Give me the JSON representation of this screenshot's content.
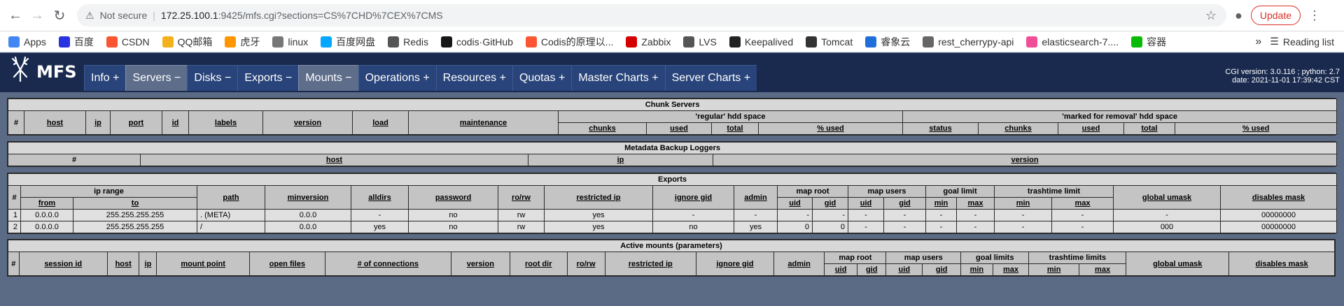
{
  "browser": {
    "not_secure": "Not secure",
    "url_host": "172.25.100.1",
    "url_rest": ":9425/mfs.cgi?sections=CS%7CHD%7CEX%7CMS",
    "update_label": "Update",
    "bookmarks": [
      {
        "label": "Apps",
        "icon": "apps-grid-icon",
        "color": "#4285f4"
      },
      {
        "label": "百度",
        "icon": "baidu-paw-icon",
        "color": "#2932e1"
      },
      {
        "label": "CSDN",
        "icon": "csdn-icon",
        "color": "#fc5531"
      },
      {
        "label": "QQ邮箱",
        "icon": "qqmail-icon",
        "color": "#f3b21b"
      },
      {
        "label": "虎牙",
        "icon": "huya-icon",
        "color": "#ff9600"
      },
      {
        "label": "linux",
        "icon": "linux-icon",
        "color": "#777777"
      },
      {
        "label": "百度网盘",
        "icon": "baidu-pan-icon",
        "color": "#06a7ff"
      },
      {
        "label": "Redis",
        "icon": "redis-icon",
        "color": "#555555"
      },
      {
        "label": "codis·GitHub",
        "icon": "github-icon",
        "color": "#181717"
      },
      {
        "label": "Codis的原理以...",
        "icon": "csdn-icon",
        "color": "#fc5531"
      },
      {
        "label": "Zabbix",
        "icon": "zabbix-icon",
        "color": "#d40000"
      },
      {
        "label": "LVS",
        "icon": "lvs-icon",
        "color": "#555555"
      },
      {
        "label": "Keepalived",
        "icon": "keepalived-icon",
        "color": "#222222"
      },
      {
        "label": "Tomcat",
        "icon": "tomcat-icon",
        "color": "#333333"
      },
      {
        "label": "睿象云",
        "icon": "ruixiang-icon",
        "color": "#1e6fd9"
      },
      {
        "label": "rest_cherrypy-api",
        "icon": "cherrypy-icon",
        "color": "#666666"
      },
      {
        "label": "elasticsearch-7....",
        "icon": "elastic-icon",
        "color": "#f04e98"
      },
      {
        "label": "容器",
        "icon": "wechat-icon",
        "color": "#09bb07"
      }
    ],
    "reading_list": "Reading list"
  },
  "mfs": {
    "logo_text": "MFS",
    "tabs": [
      {
        "label": "Info +",
        "active": false
      },
      {
        "label": "Servers −",
        "active": true
      },
      {
        "label": "Disks −",
        "active": false
      },
      {
        "label": "Exports −",
        "active": false
      },
      {
        "label": "Mounts −",
        "active": true
      },
      {
        "label": "Operations +",
        "active": false
      },
      {
        "label": "Resources +",
        "active": false
      },
      {
        "label": "Quotas +",
        "active": false
      },
      {
        "label": "Master Charts +",
        "active": false
      },
      {
        "label": "Server Charts +",
        "active": false
      }
    ],
    "version_line1": "CGI version: 3.0.116 ; python: 2.7",
    "version_line2": "date: 2021-11-01 17:39:42 CST"
  },
  "chunk_servers": {
    "title": "Chunk Servers",
    "cols": [
      "#",
      "host",
      "ip",
      "port",
      "id",
      "labels",
      "version",
      "load",
      "maintenance"
    ],
    "regular_title": "'regular' hdd space",
    "regular_cols": [
      "chunks",
      "used",
      "total",
      "% used"
    ],
    "removal_title": "'marked for removal' hdd space",
    "removal_cols": [
      "status",
      "chunks",
      "used",
      "total",
      "% used"
    ]
  },
  "backup_loggers": {
    "title": "Metadata Backup Loggers",
    "cols": [
      "#",
      "host",
      "ip",
      "version"
    ]
  },
  "exports": {
    "title": "Exports",
    "h": {
      "num": "#",
      "ip_range": "ip range",
      "from": "from",
      "to": "to",
      "path": "path",
      "minversion": "minversion",
      "alldirs": "alldirs",
      "password": "password",
      "rorw": "ro/rw",
      "restricted_ip": "restricted ip",
      "ignore_gid": "ignore gid",
      "admin": "admin",
      "map_root": "map root",
      "map_users": "map users",
      "uid": "uid",
      "gid": "gid",
      "goal_limit": "goal limit",
      "trashtime_limit": "trashtime limit",
      "min": "min",
      "max": "max",
      "global_umask": "global umask",
      "disables_mask": "disables mask"
    },
    "rows": [
      [
        "1",
        "0.0.0.0",
        "255.255.255.255",
        ". (META)",
        "0.0.0",
        "-",
        "no",
        "rw",
        "yes",
        "-",
        "-",
        "-",
        "-",
        "-",
        "-",
        "-",
        "-",
        "-",
        "-",
        "-",
        "00000000"
      ],
      [
        "2",
        "0.0.0.0",
        "255.255.255.255",
        "/",
        "0.0.0",
        "yes",
        "no",
        "rw",
        "yes",
        "no",
        "yes",
        "0",
        "0",
        "-",
        "-",
        "-",
        "-",
        "-",
        "-",
        "000",
        "00000000"
      ]
    ]
  },
  "mounts": {
    "title": "Active mounts (parameters)",
    "h": {
      "num": "#",
      "session_id": "session id",
      "host": "host",
      "ip": "ip",
      "mount_point": "mount point",
      "open_files": "open files",
      "connections": "# of connections",
      "version": "version",
      "root_dir": "root dir",
      "rorw": "ro/rw",
      "restricted_ip": "restricted ip",
      "ignore_gid": "ignore gid",
      "admin": "admin",
      "map_root": "map root",
      "map_users": "map users",
      "uid": "uid",
      "gid": "gid",
      "goal_limits": "goal limits",
      "trashtime_limits": "trashtime limits",
      "min": "min",
      "max": "max",
      "global_umask": "global umask",
      "disables_mask": "disables mask"
    }
  }
}
